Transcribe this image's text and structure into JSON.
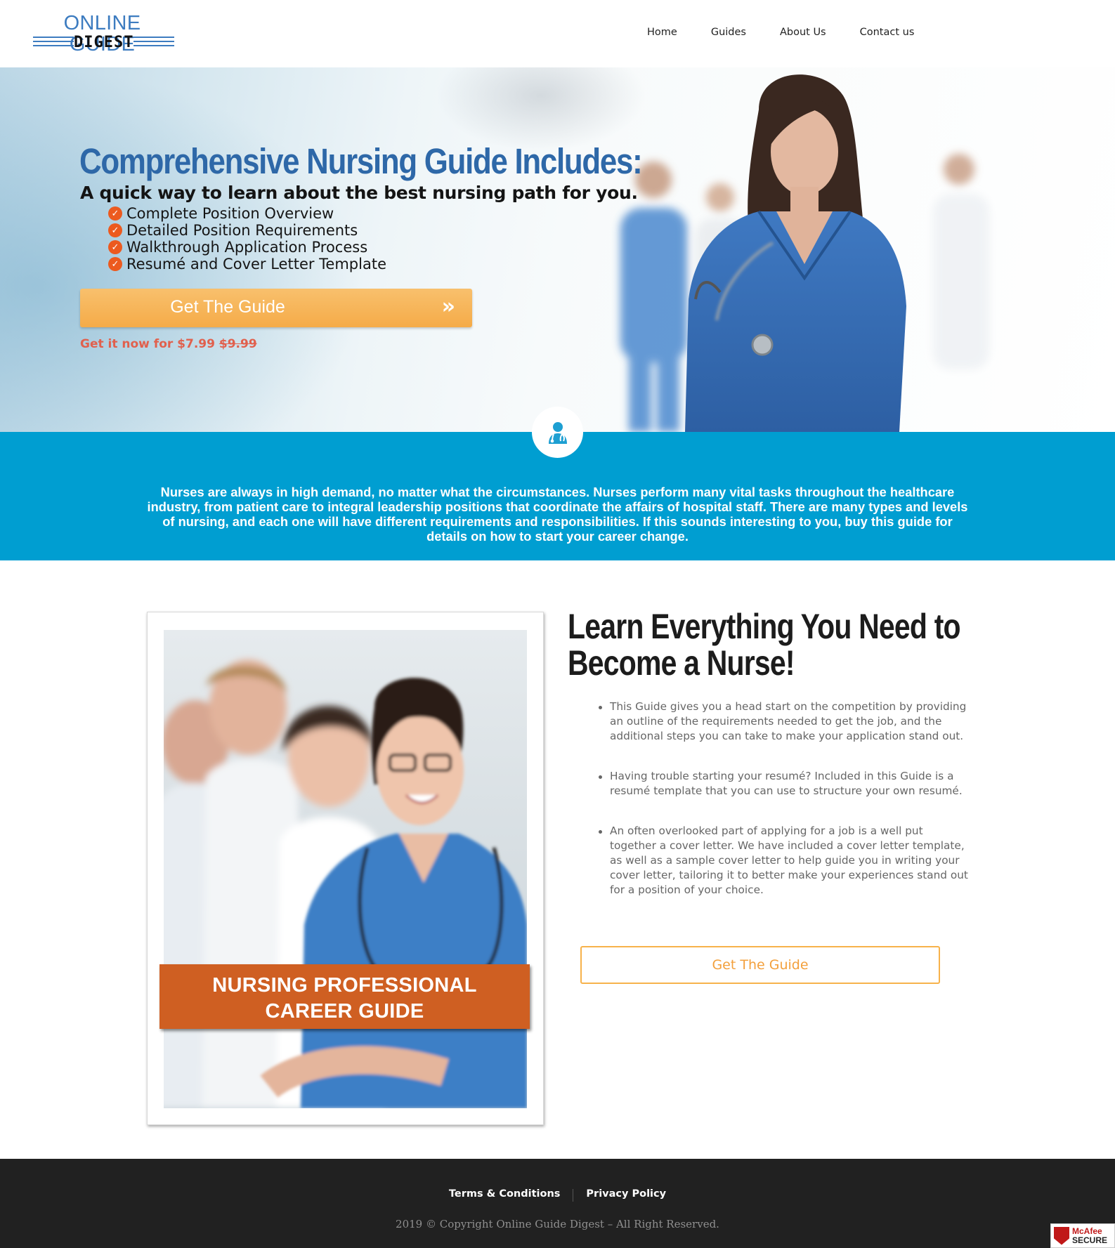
{
  "header": {
    "logo_top": "ONLINE GUIDE",
    "logo_bottom": "DIGEST",
    "nav": [
      "Home",
      "Guides",
      "About Us",
      "Contact us"
    ]
  },
  "hero": {
    "title": "Comprehensive Nursing Guide Includes:",
    "subtitle": "A quick way to learn about the best nursing path for you.",
    "features": [
      "Complete Position Overview",
      "Detailed Position Requirements",
      "Walkthrough Application Process",
      "Resumé and Cover Letter Template"
    ],
    "cta_label": "Get The Guide",
    "cta_arrow": "»",
    "price_prefix": "Get it now for $7.99 ",
    "price_old": "$9.99"
  },
  "band": {
    "icon": "nurse-icon",
    "text": "Nurses are always in high demand, no matter what the circumstances. Nurses perform many vital tasks throughout the healthcare industry, from patient care to integral leadership positions that coordinate the affairs of hospital staff. There are many types and levels of nursing, and each one will have different requirements and responsibilities. If this sounds interesting to you, buy this guide for details on how to start your career change."
  },
  "product": {
    "cover_line1": "NURSING PROFESSIONAL",
    "cover_line2": "CAREER GUIDE",
    "title": "Learn Everything You Need to Become a Nurse!",
    "title_line1": "Learn Everything You Need to",
    "title_line2": "Become a Nurse!",
    "bullets": [
      "This Guide gives you a head start on the competition by providing an outline of the requirements needed to get the job, and the additional steps you can take to make your application stand out.",
      "Having trouble starting your resumé?  Included in this Guide is a resumé template that you can use to structure your own resumé.",
      "An often overlooked part of applying for a job is a well put together a cover letter. We have included a cover letter template, as well as a sample cover letter to help guide you in writing your cover letter, tailoring it to better make your experiences stand out for a position of your choice."
    ],
    "cta_label": "Get The Guide"
  },
  "footer": {
    "links": [
      "Terms & Conditions",
      "Privacy Policy"
    ],
    "copyright": "2019 © Copyright Online Guide Digest – All Right Reserved.",
    "badge_brand": "McAfee",
    "badge_label": "SECURE"
  },
  "colors": {
    "brand_blue": "#2e68a8",
    "band_blue": "#009ed1",
    "cta_orange": "#f5ab48",
    "price_red": "#e1604d",
    "check_orange": "#ec5a1f",
    "cover_orange": "#cf5f22",
    "footer_bg": "#212121"
  }
}
